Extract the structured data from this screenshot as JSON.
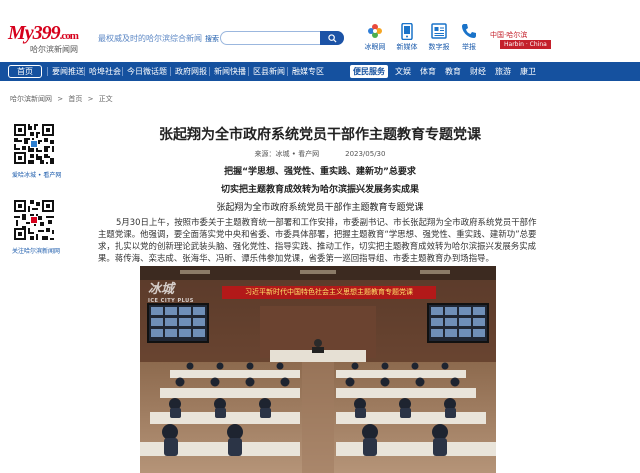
{
  "header": {
    "logo": {
      "main": "My399",
      "suffix": ".com",
      "sub": "哈尔滨新闻网"
    },
    "slogan": "最权威及时的哈尔滨综合新闻",
    "search": {
      "label": "搜索",
      "placeholder": ""
    },
    "apps": [
      {
        "label": "冰眼网",
        "icon": "flower-icon"
      },
      {
        "label": "新媒体",
        "icon": "phone-icon"
      },
      {
        "label": "数字报",
        "icon": "newspaper-icon"
      },
      {
        "label": "举报",
        "icon": "telephone-icon"
      }
    ],
    "city": {
      "label": "中国·哈尔滨",
      "badge": "Harbin · China"
    }
  },
  "nav": {
    "home": "首页",
    "items": [
      "要闻推送",
      "哈埠社会",
      "今日微话题",
      "政府网报",
      "新闻快播",
      "区县新闻",
      "融媒专区"
    ],
    "service": "便民服务",
    "right_items": [
      "文娱",
      "体育",
      "教育",
      "财经",
      "旅游",
      "康卫"
    ]
  },
  "breadcrumb": [
    "哈尔滨新闻网",
    ">",
    "首页",
    ">",
    "正文"
  ],
  "sidebar": {
    "qr1_label": "爱哈冰城 • 看产网",
    "qr2_label": "关注哈尔滨新闻网"
  },
  "article": {
    "title": "张起翔为全市政府系统党员干部作主题教育专题党课",
    "source": "来源：冰城 • 看产网",
    "date": "2023/05/30",
    "subtitle1": "把握“学思想、强党性、重实践、建新功”总要求",
    "subtitle2": "切实把主题教育成效转为哈尔滨振兴发展务实成果",
    "caption": "张起翔为全市政府系统党员干部作主题教育专题党课",
    "body": "5月30日上午，按照市委关于主题教育统一部署和工作安排，市委副书记、市长张起翔为全市政府系统党员干部作主题党课。他强调，要全面落实党中央和省委、市委具体部署，把握主题教育“学思想、强党性、重实践、建新功”总要求，扎实以党的创新理论武装头脑、强化党性、指导实践、推动工作，切实把主题教育成效转为哈尔滨振兴发展务实成果。蒋传海、栾志成、张海华、冯昕、谭乐伟参加党课，省委第一巡回指导组、市委主题教育办到场指导。",
    "photo": {
      "watermark": "冰城",
      "watermark_sub": "ICE CITY PLUS",
      "banner": "习近平新时代中国特色社会主义思想主题教育专题党课"
    }
  },
  "colors": {
    "brand_red": "#d6001c",
    "nav_blue": "#15519f",
    "link_blue": "#1a5aab"
  }
}
